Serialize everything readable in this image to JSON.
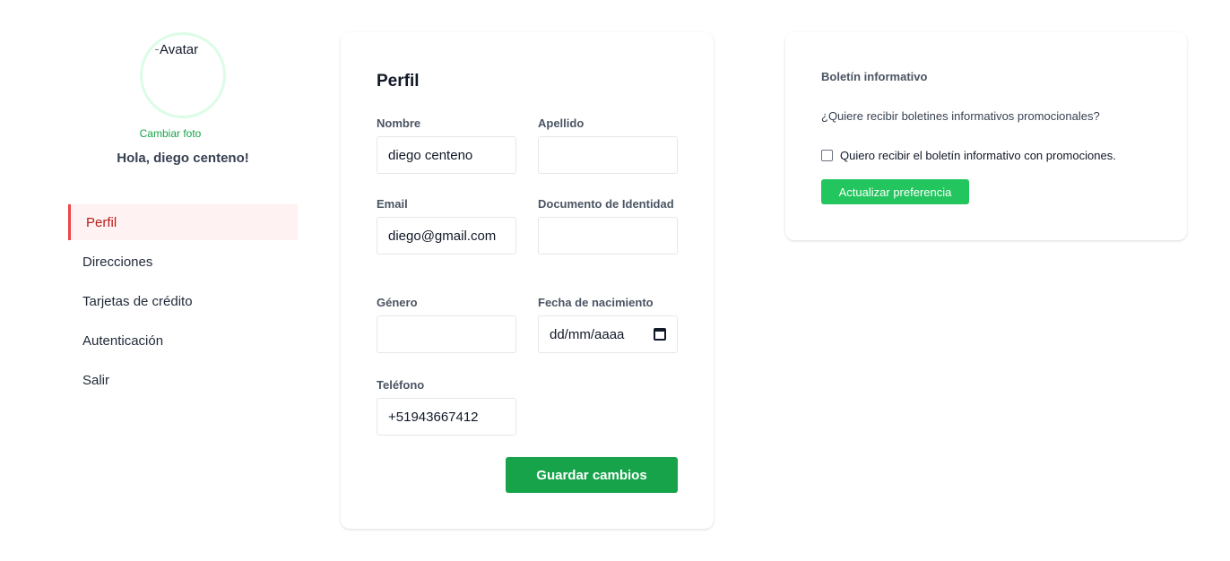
{
  "sidebar": {
    "avatar_alt": "Avatar",
    "change_photo": "Cambiar foto",
    "greeting": "Hola, diego centeno!",
    "items": [
      {
        "label": "Perfil",
        "active": true
      },
      {
        "label": "Direcciones"
      },
      {
        "label": "Tarjetas de crédito"
      },
      {
        "label": "Autenticación"
      },
      {
        "label": "Salir"
      }
    ]
  },
  "profile": {
    "title": "Perfil",
    "fields": {
      "nombre": {
        "label": "Nombre",
        "value": "diego centeno"
      },
      "apellido": {
        "label": "Apellido",
        "value": ""
      },
      "email": {
        "label": "Email",
        "value": "diego@gmail.com"
      },
      "documento": {
        "label": "Documento de Identidad",
        "value": ""
      },
      "genero": {
        "label": "Género",
        "value": ""
      },
      "fecha": {
        "label": "Fecha de nacimiento",
        "value": "dd/mm/aaaa"
      },
      "telefono": {
        "label": "Teléfono",
        "value": "+51943667412"
      }
    },
    "save_label": "Guardar cambios"
  },
  "newsletter": {
    "title": "Boletín informativo",
    "question": "¿Quiere recibir boletines informativos promocionales?",
    "checkbox_label": "Quiero recibir el boletín informativo con promociones.",
    "checked": false,
    "button_label": "Actualizar preferencia"
  },
  "colors": {
    "accent_green": "#16a34a",
    "button_green_light": "#22c55e",
    "active_red": "#ef4444",
    "active_bg": "#fef2f2"
  }
}
